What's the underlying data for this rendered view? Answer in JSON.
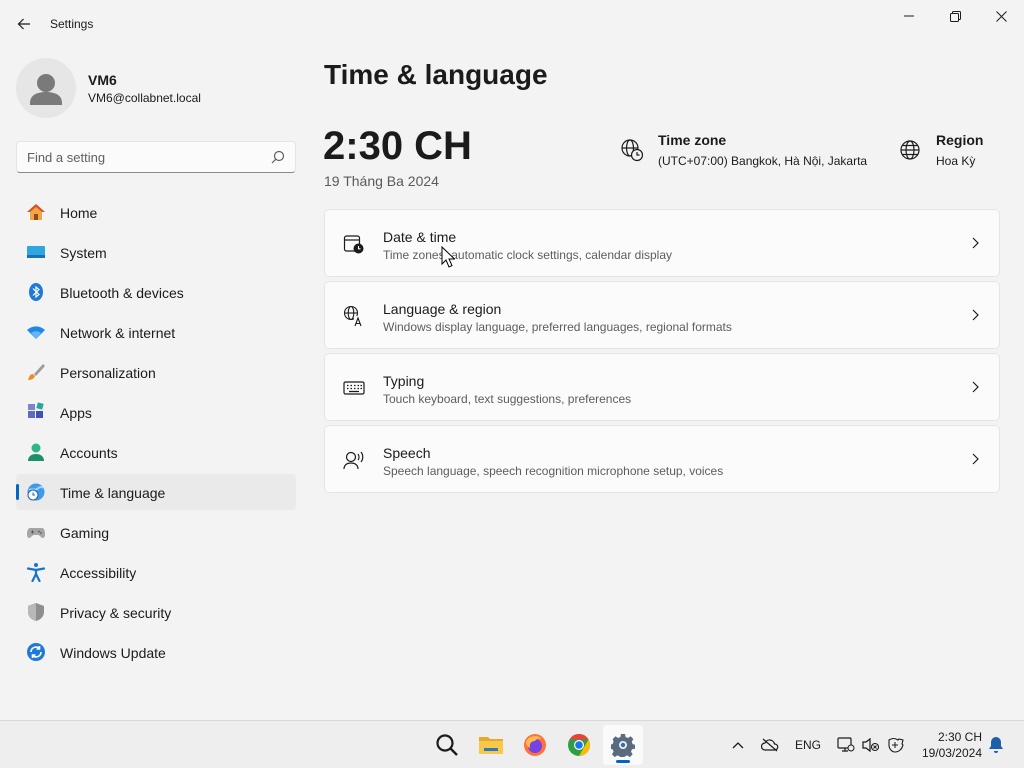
{
  "window": {
    "title": "Settings",
    "back_icon": "back-arrow-icon",
    "controls": [
      "minimize-icon",
      "maximize-icon",
      "close-icon"
    ]
  },
  "profile": {
    "name": "VM6",
    "email": "VM6@collabnet.local",
    "avatar_icon": "user-avatar-icon"
  },
  "search": {
    "placeholder": "Find a setting",
    "value": "",
    "icon": "search-icon"
  },
  "sidebar": {
    "items": [
      {
        "label": "Home",
        "icon": "home-icon"
      },
      {
        "label": "System",
        "icon": "system-display-icon"
      },
      {
        "label": "Bluetooth & devices",
        "icon": "bluetooth-icon"
      },
      {
        "label": "Network & internet",
        "icon": "wifi-icon"
      },
      {
        "label": "Personalization",
        "icon": "paintbrush-icon"
      },
      {
        "label": "Apps",
        "icon": "apps-icon"
      },
      {
        "label": "Accounts",
        "icon": "accounts-icon"
      },
      {
        "label": "Time & language",
        "icon": "time-language-icon",
        "selected": true
      },
      {
        "label": "Gaming",
        "icon": "gamepad-icon"
      },
      {
        "label": "Accessibility",
        "icon": "accessibility-icon"
      },
      {
        "label": "Privacy & security",
        "icon": "shield-icon"
      },
      {
        "label": "Windows Update",
        "icon": "windows-update-icon"
      }
    ]
  },
  "main": {
    "title": "Time & language",
    "clock": "2:30 CH",
    "date": "19 Tháng Ba 2024",
    "timezone": {
      "title": "Time zone",
      "value": "(UTC+07:00) Bangkok, Hà Nội, Jakarta",
      "icon": "globe-clock-icon"
    },
    "region": {
      "title": "Region",
      "value": "Hoa Kỳ",
      "icon": "globe-icon"
    },
    "cards": [
      {
        "title": "Date & time",
        "subtitle": "Time zones, automatic clock settings, calendar display",
        "icon": "calendar-clock-icon"
      },
      {
        "title": "Language & region",
        "subtitle": "Windows display language, preferred languages, regional formats",
        "icon": "language-icon"
      },
      {
        "title": "Typing",
        "subtitle": "Touch keyboard, text suggestions, preferences",
        "icon": "keyboard-icon"
      },
      {
        "title": "Speech",
        "subtitle": "Speech language, speech recognition microphone setup, voices",
        "icon": "speech-icon"
      }
    ]
  },
  "taskbar": {
    "apps": [
      {
        "name": "search-icon"
      },
      {
        "name": "file-explorer-icon"
      },
      {
        "name": "firefox-icon"
      },
      {
        "name": "chrome-icon"
      },
      {
        "name": "settings-gear-icon",
        "active": true
      }
    ],
    "tray": {
      "language": "ENG",
      "time": "2:30 CH",
      "date": "19/03/2024"
    }
  },
  "colors": {
    "accent": "#0067c0",
    "background": "#f3f3f3",
    "card": "#fbfbfb"
  }
}
